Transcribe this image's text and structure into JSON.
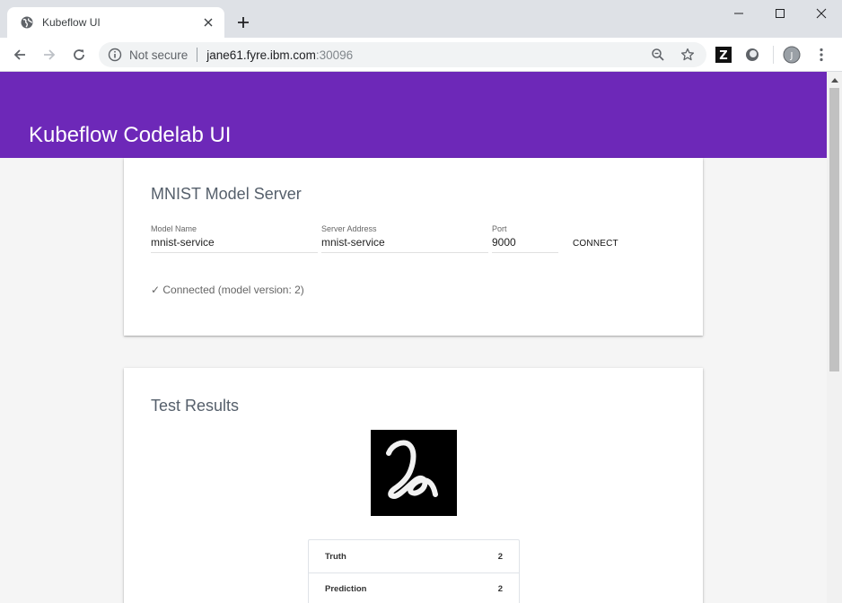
{
  "browser": {
    "tab_title": "Kubeflow UI",
    "security_label": "Not secure",
    "url_host": "jane61.fyre.ibm.com",
    "url_port": ":30096",
    "extension_z_label": "Z",
    "profile_initial": "J"
  },
  "app": {
    "title": "Kubeflow Codelab UI"
  },
  "model_server": {
    "title": "MNIST Model Server",
    "model_name_label": "Model Name",
    "model_name_value": "mnist-service",
    "server_address_label": "Server Address",
    "server_address_value": "mnist-service",
    "port_label": "Port",
    "port_value": "9000",
    "connect_label": "CONNECT",
    "status": "✓ Connected (model version: 2)"
  },
  "test_results": {
    "title": "Test Results",
    "rows": [
      {
        "label": "Truth",
        "value": "2"
      },
      {
        "label": "Prediction",
        "value": "2"
      }
    ]
  },
  "colors": {
    "app_bar": "#6d28b8",
    "page_background": "#f5f5f5",
    "chrome_frame": "#dee1e6"
  }
}
